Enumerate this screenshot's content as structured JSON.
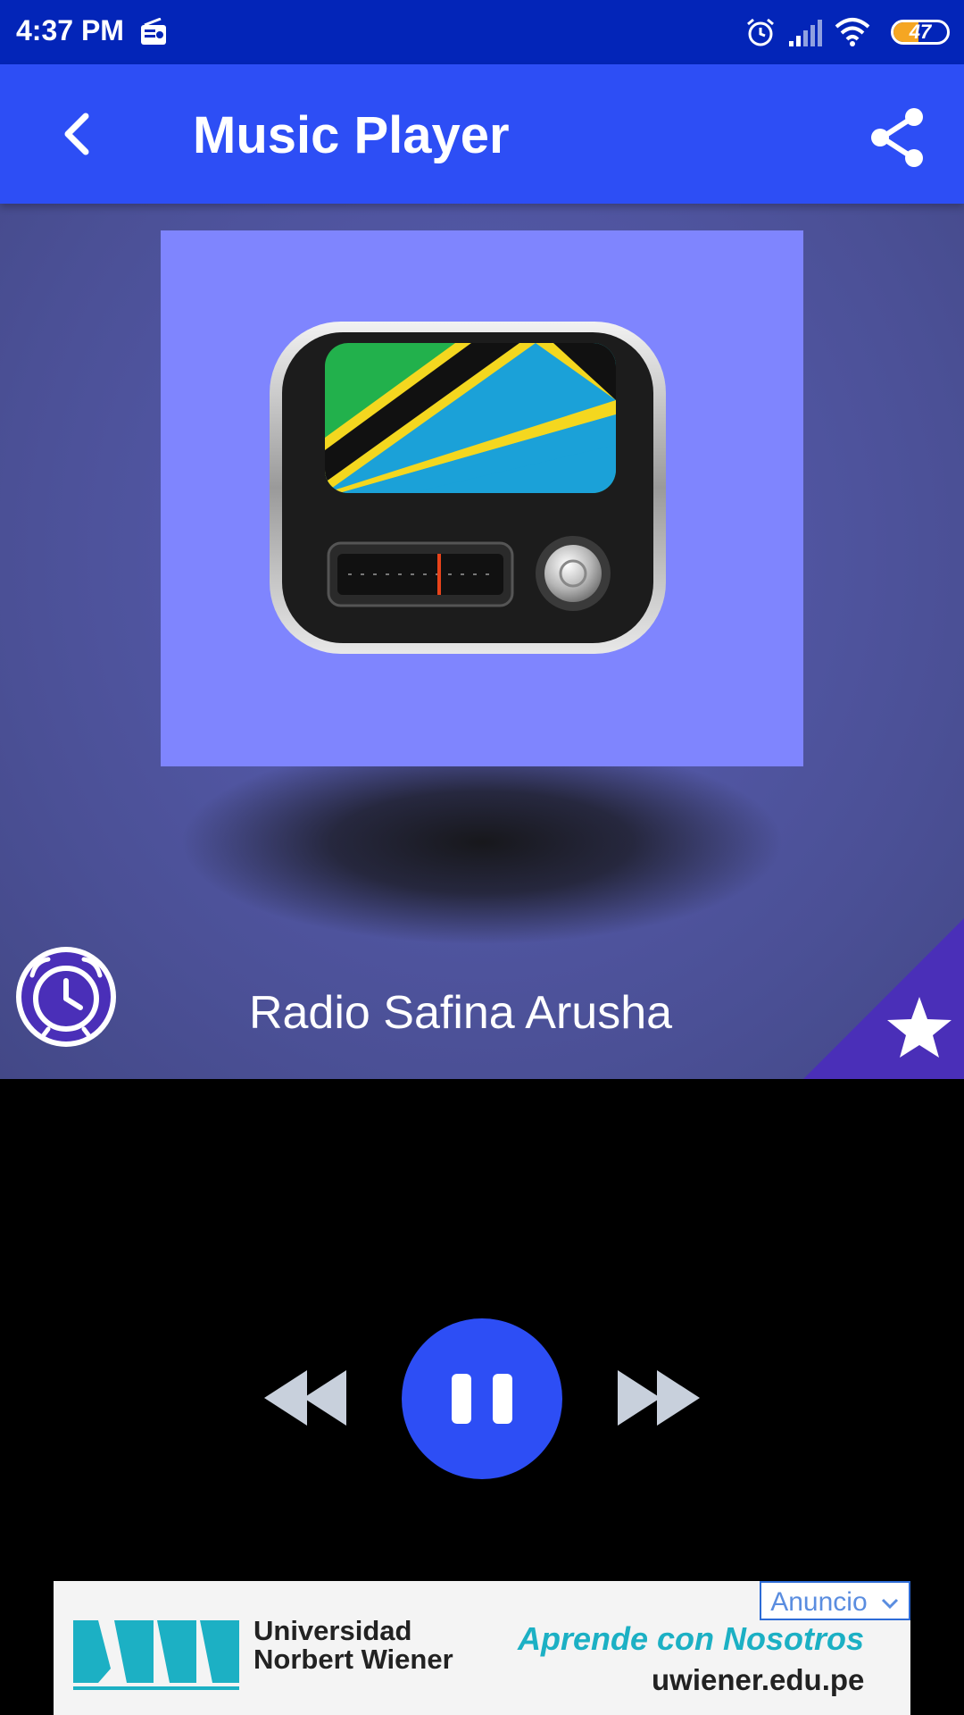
{
  "status_bar": {
    "time": "4:37 PM",
    "battery": "47",
    "battery_level": 0.47,
    "icons": [
      "radio-icon",
      "alarm-icon",
      "signal-icon",
      "wifi-icon",
      "battery-icon"
    ]
  },
  "app_bar": {
    "title": "Music Player",
    "back_icon": "chevron-left-icon",
    "share_icon": "share-icon",
    "background": "#2d4ef5"
  },
  "player": {
    "station_name": "Radio Safina Arusha",
    "artwork_background": "#7f85fe",
    "artwork_icon": "tanzania-flag-radio-icon",
    "alarm_icon": "alarm-clock-icon",
    "favorite_icon": "star-icon"
  },
  "controls": {
    "previous_icon": "rewind-icon",
    "play_pause_icon": "pause-icon",
    "next_icon": "fast-forward-icon",
    "accent": "#2d4ef5"
  },
  "ad": {
    "badge": "Anuncio",
    "org_line1": "Universidad",
    "org_line2": "Norbert Wiener",
    "tagline": "Aprende con Nosotros",
    "url": "uwiener.edu.pe"
  }
}
